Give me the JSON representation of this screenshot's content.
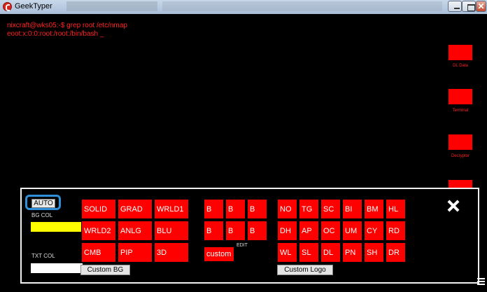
{
  "window": {
    "title": "GeekTyper",
    "close_glyph": "✕"
  },
  "terminal": {
    "lines": [
      "nixcraft@wks05:-$ grep root /etc/nmap",
      "eoot:x:0:0:root:/root:/bin/bash _"
    ]
  },
  "side_buttons": [
    {
      "label": "DL Data"
    },
    {
      "label": "Terminal"
    },
    {
      "label": "Decryptor"
    },
    {
      "label": ""
    }
  ],
  "panel": {
    "auto_label": "AUTO",
    "bg_col_label": "BG COL",
    "txt_col_label": "TXT COL",
    "bg_color": "#ffff00",
    "txt_color": "#ffffff",
    "custom_bg_label": "Custom BG",
    "style_buttons": [
      "SOLID",
      "GRAD",
      "WRLD1",
      "WRLD2",
      "ANLG",
      "BLU",
      "CMB",
      "PIP",
      "3D"
    ],
    "b_buttons": [
      "B",
      "B",
      "B",
      "B",
      "B",
      "B"
    ],
    "custom_label": "custom",
    "edit_label": "EDIT",
    "logo_buttons": [
      "NO",
      "TG",
      "SC",
      "BI",
      "BM",
      "HL",
      "DH",
      "AP",
      "OC",
      "UM",
      "CY",
      "RD",
      "WL",
      "SL",
      "DL",
      "PN",
      "SH",
      "DR"
    ],
    "custom_logo_label": "Custom Logo",
    "close_icon": "close-icon"
  },
  "colors": {
    "accent": "#ff0000",
    "focus_ring": "#2e8fd8",
    "text": "#ff2222"
  }
}
